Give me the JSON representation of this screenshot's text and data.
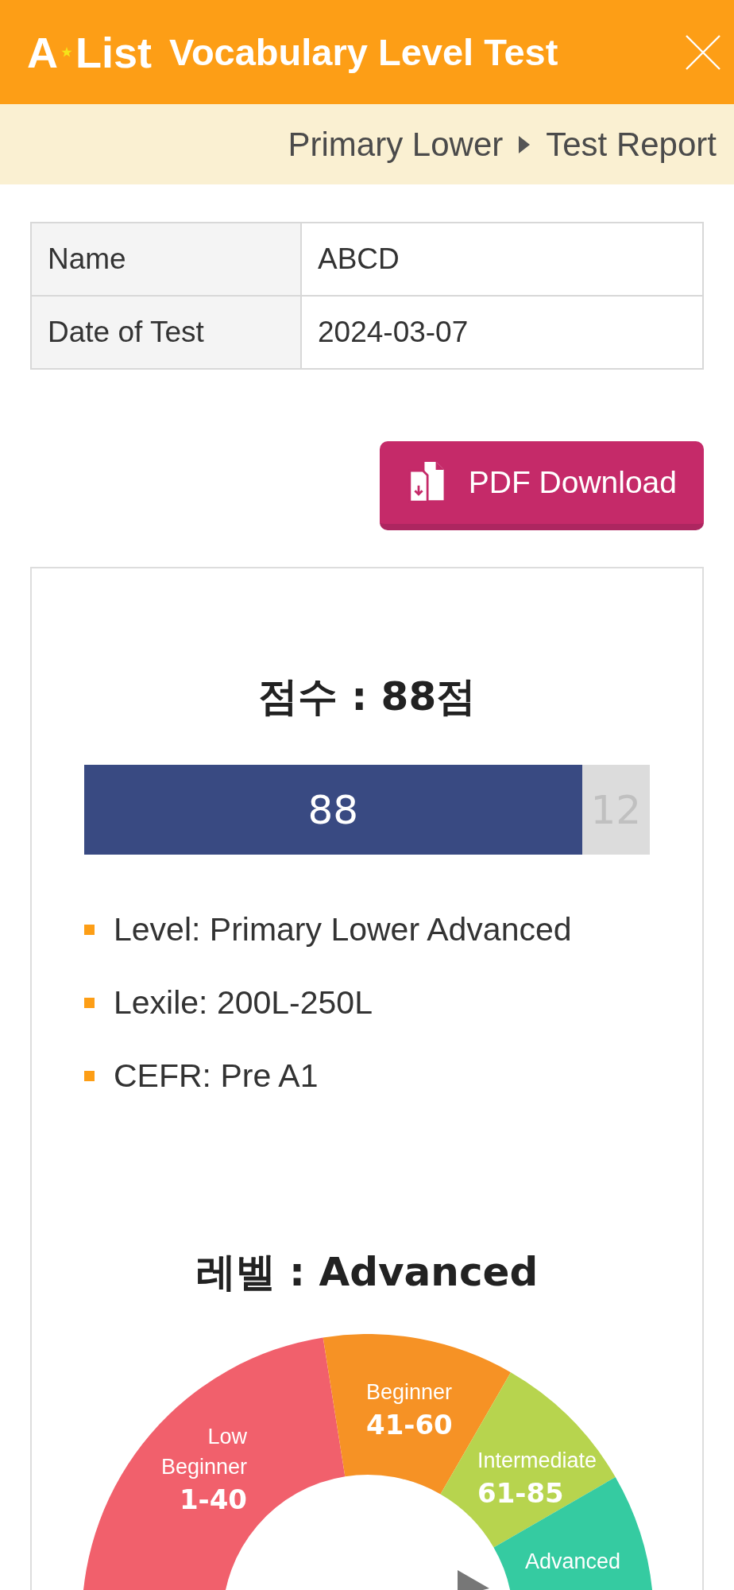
{
  "header": {
    "logo": {
      "letter": "A",
      "word": "List"
    },
    "title": "Vocabulary Level Test"
  },
  "breadcrumb": [
    "Primary Lower",
    "Test Report"
  ],
  "info_table": {
    "rows": [
      {
        "label": "Name",
        "value": "ABCD"
      },
      {
        "label": "Date of Test",
        "value": "2024-03-07"
      }
    ]
  },
  "download_button": {
    "label": "PDF Download"
  },
  "score": {
    "title": "점수 : 88점",
    "bar": {
      "level": 0.88,
      "score_label": "88",
      "rest_label": "12"
    },
    "details": [
      "Level: Primary Lower Advanced",
      "Lexile: 200L-250L",
      "CEFR: Pre A1"
    ]
  },
  "level": {
    "title": "레벨 : Advanced",
    "gauge_segments": [
      {
        "lines": [
          "Low",
          "Beginner"
        ],
        "range": "1-40",
        "color": "#f1606c"
      },
      {
        "lines": [
          "Beginner"
        ],
        "range": "41-60",
        "color": "#f69225"
      },
      {
        "lines": [
          "Intermediate"
        ],
        "range": "61-85",
        "color": "#b7d44e"
      },
      {
        "lines": [
          "Advanced"
        ],
        "color": "#35cba1"
      }
    ]
  }
}
